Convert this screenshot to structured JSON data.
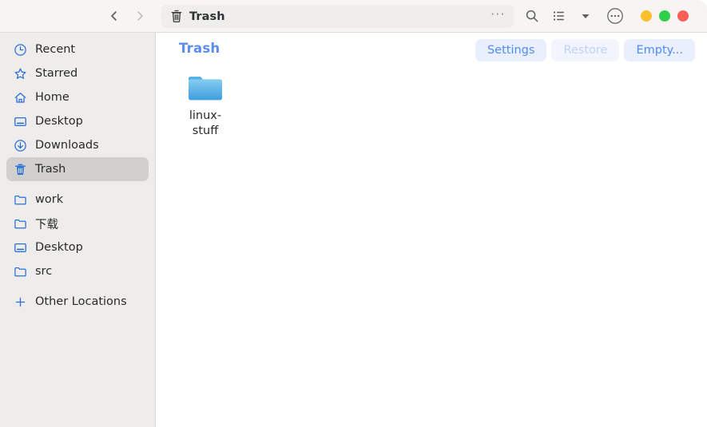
{
  "window": {
    "title": "Trash",
    "controls": {
      "minimize": {
        "name": "minimize",
        "color": "#fcc02e"
      },
      "maximize": {
        "name": "maximize",
        "color": "#2ed04a"
      },
      "close": {
        "name": "close",
        "color": "#fb5f57"
      }
    }
  },
  "header": {
    "back_icon": "chevron-left-icon",
    "forward_icon": "chevron-right-icon",
    "pathbar": {
      "icon": "trash-icon",
      "label": "Trash",
      "overflow": "···"
    },
    "search_icon": "search-icon",
    "view_list_icon": "list-view-icon",
    "view_dropdown_icon": "chevron-down-icon",
    "menu_icon": "more-options-icon"
  },
  "sidebar": {
    "items": [
      {
        "label": "Recent",
        "icon": "clock-icon",
        "selected": false
      },
      {
        "label": "Starred",
        "icon": "star-icon",
        "selected": false
      },
      {
        "label": "Home",
        "icon": "home-icon",
        "selected": false
      },
      {
        "label": "Desktop",
        "icon": "desktop-icon",
        "selected": false
      },
      {
        "label": "Downloads",
        "icon": "download-icon",
        "selected": false
      },
      {
        "label": "Trash",
        "icon": "trash-icon",
        "selected": true
      },
      {
        "label": "work",
        "icon": "folder-icon",
        "selected": false
      },
      {
        "label": "下载",
        "icon": "folder-icon",
        "selected": false
      },
      {
        "label": "Desktop",
        "icon": "desktop-icon",
        "selected": false
      },
      {
        "label": "src",
        "icon": "folder-icon",
        "selected": false
      },
      {
        "label": "Other Locations",
        "icon": "plus-icon",
        "selected": false
      }
    ]
  },
  "main": {
    "title": "Trash",
    "title_color": "#5c8ded",
    "actions": [
      {
        "label": "Settings",
        "enabled": true
      },
      {
        "label": "Restore",
        "enabled": false
      },
      {
        "label": "Empty...",
        "enabled": true
      }
    ],
    "files": [
      {
        "name": "linux-stuff",
        "icon": "folder-icon"
      }
    ]
  }
}
